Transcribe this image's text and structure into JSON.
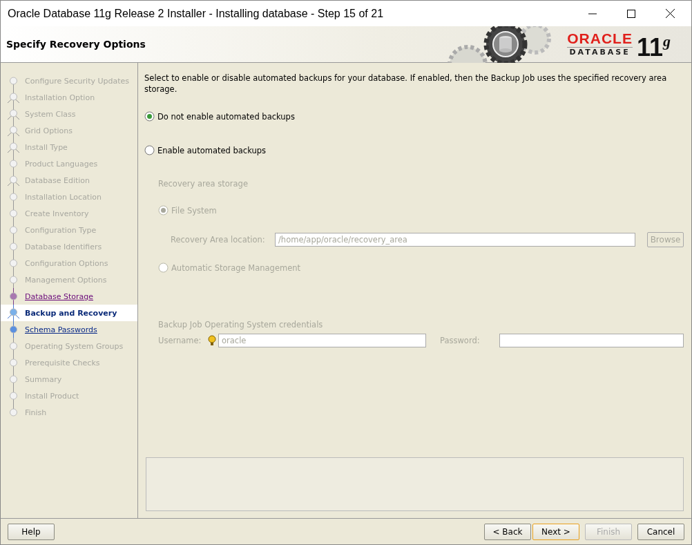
{
  "window": {
    "title": "Oracle Database 11g Release 2 Installer - Installing database - Step 15 of 21"
  },
  "header": {
    "title": "Specify Recovery Options",
    "logo_brand": "ORACLE",
    "logo_product": "DATABASE",
    "logo_version": "11",
    "logo_suffix": "g"
  },
  "steps": [
    {
      "label": "Configure Security Updates",
      "kind": "dot",
      "selected": false,
      "enabled": false,
      "visited": false
    },
    {
      "label": "Installation Option",
      "kind": "branch",
      "selected": false,
      "enabled": false,
      "visited": false
    },
    {
      "label": "System Class",
      "kind": "branch",
      "selected": false,
      "enabled": false,
      "visited": false
    },
    {
      "label": "Grid Options",
      "kind": "branch",
      "selected": false,
      "enabled": false,
      "visited": false
    },
    {
      "label": "Install Type",
      "kind": "branch",
      "selected": false,
      "enabled": false,
      "visited": false
    },
    {
      "label": "Product Languages",
      "kind": "dot",
      "selected": false,
      "enabled": false,
      "visited": false
    },
    {
      "label": "Database Edition",
      "kind": "branch",
      "selected": false,
      "enabled": false,
      "visited": false
    },
    {
      "label": "Installation Location",
      "kind": "dot",
      "selected": false,
      "enabled": false,
      "visited": false
    },
    {
      "label": "Create Inventory",
      "kind": "dot",
      "selected": false,
      "enabled": false,
      "visited": false
    },
    {
      "label": "Configuration Type",
      "kind": "dot",
      "selected": false,
      "enabled": false,
      "visited": false
    },
    {
      "label": "Database Identifiers",
      "kind": "dot",
      "selected": false,
      "enabled": false,
      "visited": false
    },
    {
      "label": "Configuration Options",
      "kind": "dot",
      "selected": false,
      "enabled": false,
      "visited": false
    },
    {
      "label": "Management Options",
      "kind": "dot",
      "selected": false,
      "enabled": false,
      "visited": false
    },
    {
      "label": "Database Storage",
      "kind": "dot",
      "selected": false,
      "enabled": true,
      "visited": true
    },
    {
      "label": "Backup and Recovery",
      "kind": "branch",
      "selected": true,
      "enabled": true,
      "visited": false
    },
    {
      "label": "Schema Passwords",
      "kind": "dot",
      "selected": false,
      "enabled": true,
      "visited": false
    },
    {
      "label": "Operating System Groups",
      "kind": "dot",
      "selected": false,
      "enabled": false,
      "visited": false
    },
    {
      "label": "Prerequisite Checks",
      "kind": "dot",
      "selected": false,
      "enabled": false,
      "visited": false
    },
    {
      "label": "Summary",
      "kind": "dot",
      "selected": false,
      "enabled": false,
      "visited": false
    },
    {
      "label": "Install Product",
      "kind": "dot",
      "selected": false,
      "enabled": false,
      "visited": false
    },
    {
      "label": "Finish",
      "kind": "dot",
      "selected": false,
      "enabled": false,
      "visited": false
    }
  ],
  "content": {
    "description": "Select to enable or disable automated backups for your database. If enabled, then the Backup Job uses the specified recovery area storage.",
    "backup_options": [
      {
        "label": "Do not enable automated backups",
        "selected": true
      },
      {
        "label": "Enable automated backups",
        "selected": false
      }
    ],
    "storage_heading": "Recovery area storage",
    "storage_disabled": true,
    "storage_options": [
      {
        "label": "File System",
        "selected": true
      },
      {
        "label": "Automatic Storage Management",
        "selected": false
      }
    ],
    "location_label": "Recovery Area location:",
    "location_value": "/home/app/oracle/recovery_area",
    "browse": "Browse",
    "credentials_heading": "Backup Job Operating System credentials",
    "username_label": "Username:",
    "username_value": "oracle",
    "password_label": "Password:"
  },
  "buttons": [
    {
      "label": "Help",
      "disabled": false,
      "default": false
    },
    {
      "label": "< Back",
      "disabled": false,
      "default": false
    },
    {
      "label": "Next >",
      "disabled": false,
      "default": true
    },
    {
      "label": "Finish",
      "disabled": true,
      "default": false
    },
    {
      "label": "Cancel",
      "disabled": false,
      "default": false
    }
  ]
}
